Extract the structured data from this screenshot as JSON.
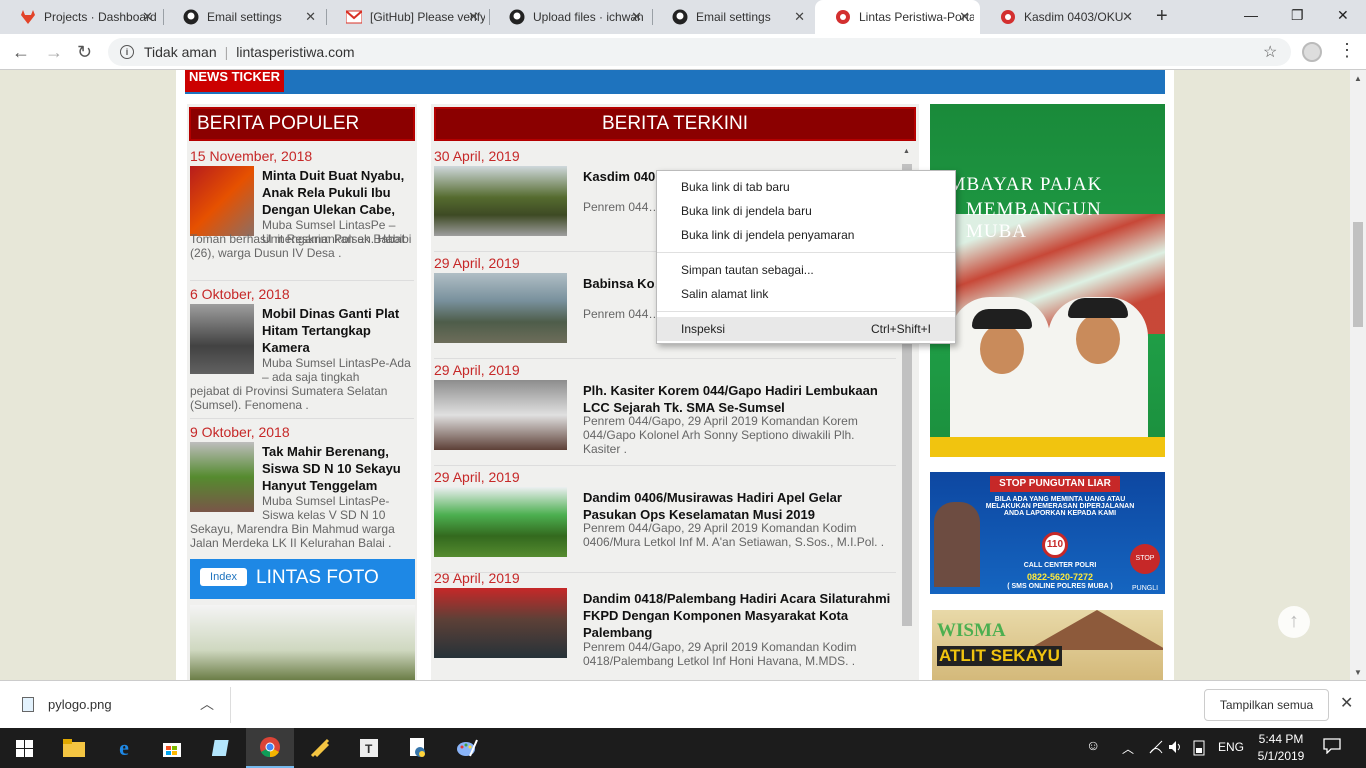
{
  "browser": {
    "tabs": [
      {
        "title": "Projects · Dashboard",
        "icon": "gitlab-icon"
      },
      {
        "title": "Email settings",
        "icon": "github-icon"
      },
      {
        "title": "[GitHub] Please verify",
        "icon": "gmail-icon"
      },
      {
        "title": "Upload files · ichwan",
        "icon": "github-icon"
      },
      {
        "title": "Email settings",
        "icon": "github-icon"
      },
      {
        "title": "Lintas Peristiwa-Portal",
        "icon": "site-icon"
      },
      {
        "title": "Kasdim 0403/OKU",
        "icon": "site-icon"
      }
    ],
    "security_label": "Tidak aman",
    "url": "lintasperistiwa.com"
  },
  "site": {
    "ticker_label": "NEWS TICKER",
    "populer": {
      "heading": "BERITA POPULER",
      "items": [
        {
          "date": "15 November, 2018",
          "title": "Minta Duit Buat Nyabu, Anak Rela Pukuli Ibu Dengan Ulekan Cabe,",
          "desc_inline": "Muba Sumsel LintasPe – Unit Reskrim Polsek Babat",
          "desc_rest": "Toman berhasil mengamankan an. Habibi (26), warga Dusun IV Desa ."
        },
        {
          "date": "6 Oktober, 2018",
          "title": "Mobil Dinas Ganti Plat Hitam Tertangkap Kamera",
          "desc_inline": "  Muba Sumsel LintasPe-Ada – ada saja tingkah",
          "desc_rest": "pejabat di Provinsi Sumatera Selatan (Sumsel). Fenomena ."
        },
        {
          "date": "9 Oktober, 2018",
          "title": "Tak Mahir Berenang, Siswa SD N 10 Sekayu Hanyut Tenggelam",
          "desc_inline": "Muba Sumsel LintasPe-Siswa kelas V SD N 10",
          "desc_rest": "Sekayu, Marendra Bin Mahmud warga Jalan Merdeka LK II Kelurahan Balai ."
        }
      ]
    },
    "lintas_foto": {
      "index_label": "Index",
      "heading": "LINTAS FOTO"
    },
    "terkini": {
      "heading": "BERITA TERKINI",
      "items": [
        {
          "date": "30 April, 2019",
          "title": "Kasdim 040… Keselamata…",
          "desc": "Penrem 044… 0403/OKU Le… diwakili Kasdi…"
        },
        {
          "date": "29 April, 2019",
          "title": "Babinsa Ko… Pendamping…",
          "desc": "Penrem 044… Desa (Babins… 0406/Mura ."
        },
        {
          "date": "29 April, 2019",
          "title": "Plh. Kasiter Korem 044/Gapo Hadiri Lembukaan LCC Sejarah Tk. SMA Se-Sumsel",
          "desc": "  Penrem 044/Gapo, 29 April  2019 Komandan Korem 044/Gapo Kolonel Arh Sonny Septiono diwakili Plh. Kasiter ."
        },
        {
          "date": "29 April, 2019",
          "title": "Dandim 0406/Musirawas Hadiri Apel Gelar Pasukan Ops Keselamatan Musi 2019",
          "desc": "  Penrem 044/Gapo, 29 April  2019 Komandan Kodim 0406/Mura Letkol Inf M. A'an Setiawan, S.Sos., M.I.Pol. ."
        },
        {
          "date": "29 April, 2019",
          "title": "Dandim 0418/Palembang Hadiri Acara Silaturahmi FKPD Dengan Komponen Masyarakat Kota Palembang",
          "desc": "  Penrem 044/Gapo, 29 April  2019 Komandan Kodim 0418/Palembang Letkol Inf Honi Havana, M.MDS. ."
        }
      ]
    },
    "ads": {
      "ad1_line1": "EMBAYAR PAJAK",
      "ad1_line2": "MEMBANGUN MUBA",
      "ad2_head": "STOP PUNGUTAN LIAR",
      "ad2_text": "BILA ADA YANG MEMINTA UANG ATAU MELAKUKAN PEMERASAN DIPERJALANAN ANDA LAPORKAN KEPADA KAMI",
      "ad2_number": "110",
      "ad2_call": "CALL CENTER POLRI",
      "ad2_phone": "0822-5620-7272",
      "ad2_sms": "( SMS ONLINE POLRES MUBA )",
      "ad2_stop": "STOP PUNGLI",
      "ad3_line1": "WISMA",
      "ad3_line2": "ATLIT SEKAYU"
    }
  },
  "context_menu": {
    "items": [
      {
        "label": "Buka link di tab baru"
      },
      {
        "label": "Buka link di jendela baru"
      },
      {
        "label": "Buka link di jendela penyamaran"
      },
      {
        "label": "Simpan tautan sebagai..."
      },
      {
        "label": "Salin alamat link"
      },
      {
        "label": "Inspeksi",
        "shortcut": "Ctrl+Shift+I"
      }
    ]
  },
  "download_bar": {
    "file_name": "pylogo.png",
    "show_all_label": "Tampilkan semua"
  },
  "taskbar": {
    "language": "ENG",
    "time": "5:44 PM",
    "date": "5/1/2019"
  }
}
